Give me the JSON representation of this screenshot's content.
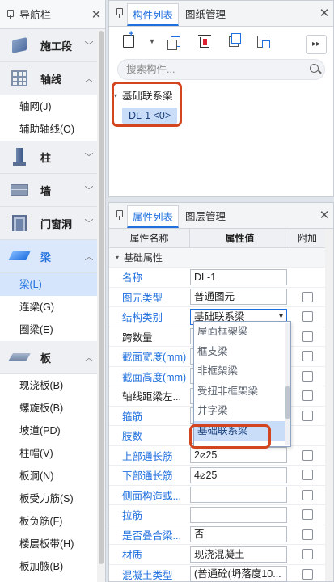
{
  "nav": {
    "title": "导航栏",
    "categories": [
      {
        "label": "施工段",
        "icon": "cube-icon"
      },
      {
        "label": "轴线",
        "icon": "grid-icon",
        "subs": [
          "轴网(J)",
          "辅助轴线(O)"
        ]
      },
      {
        "label": "柱",
        "icon": "column-icon"
      },
      {
        "label": "墙",
        "icon": "wall-icon"
      },
      {
        "label": "门窗洞",
        "icon": "door-icon"
      },
      {
        "label": "梁",
        "icon": "beam-icon",
        "subs": [
          "梁(L)",
          "连梁(G)",
          "圈梁(E)"
        ]
      },
      {
        "label": "板",
        "icon": "slab-icon",
        "subs": [
          "现浇板(B)",
          "螺旋板(B)",
          "坡道(PD)",
          "柱帽(V)",
          "板洞(N)",
          "板受力筋(S)",
          "板负筋(F)",
          "楼层板带(H)",
          "板加腋(B)"
        ]
      }
    ]
  },
  "components": {
    "tabs": [
      "构件列表",
      "图纸管理"
    ],
    "search_placeholder": "搜索构件...",
    "tree_group": "基础联系梁",
    "tree_item": "DL-1 <0>"
  },
  "properties": {
    "tabs": [
      "属性列表",
      "图层管理"
    ],
    "headers": [
      "属性名称",
      "属性值",
      "附加"
    ],
    "group": "基础属性",
    "rows": [
      {
        "name": "名称",
        "value": "DL-1",
        "blue": true,
        "check": false
      },
      {
        "name": "图元类型",
        "value": "普通图元",
        "blue": true,
        "check": true
      },
      {
        "name": "结构类别",
        "value": "基础联系梁",
        "blue": true,
        "check": true
      },
      {
        "name": "跨数量",
        "value": "",
        "blue": false,
        "check": true
      },
      {
        "name": "截面宽度(mm)",
        "value": "",
        "blue": true,
        "check": true
      },
      {
        "name": "截面高度(mm)",
        "value": "",
        "blue": true,
        "check": true
      },
      {
        "name": "轴线距梁左...",
        "value": "",
        "blue": false,
        "check": true
      },
      {
        "name": "箍筋",
        "value": "",
        "blue": true,
        "check": true
      },
      {
        "name": "肢数",
        "value": "",
        "blue": true,
        "check": false
      },
      {
        "name": "上部通长筋",
        "value": "2⌀25",
        "blue": true,
        "check": true
      },
      {
        "name": "下部通长筋",
        "value": "4⌀25",
        "blue": true,
        "check": true
      },
      {
        "name": "侧面构造或...",
        "value": "",
        "blue": true,
        "check": true
      },
      {
        "name": "拉筋",
        "value": "",
        "blue": true,
        "check": true
      },
      {
        "name": "是否叠合梁...",
        "value": "否",
        "blue": true,
        "check": true
      },
      {
        "name": "材质",
        "value": "现浇混凝土",
        "blue": true,
        "check": true
      },
      {
        "name": "混凝土类型",
        "value": "(普通砼(坍落度10...",
        "blue": true,
        "check": true
      }
    ],
    "dropdown_options": [
      "屋面框架梁",
      "框支梁",
      "非框架梁",
      "受扭非框架梁",
      "井字梁",
      "基础联系梁"
    ],
    "dropdown_selected": "基础联系梁"
  }
}
